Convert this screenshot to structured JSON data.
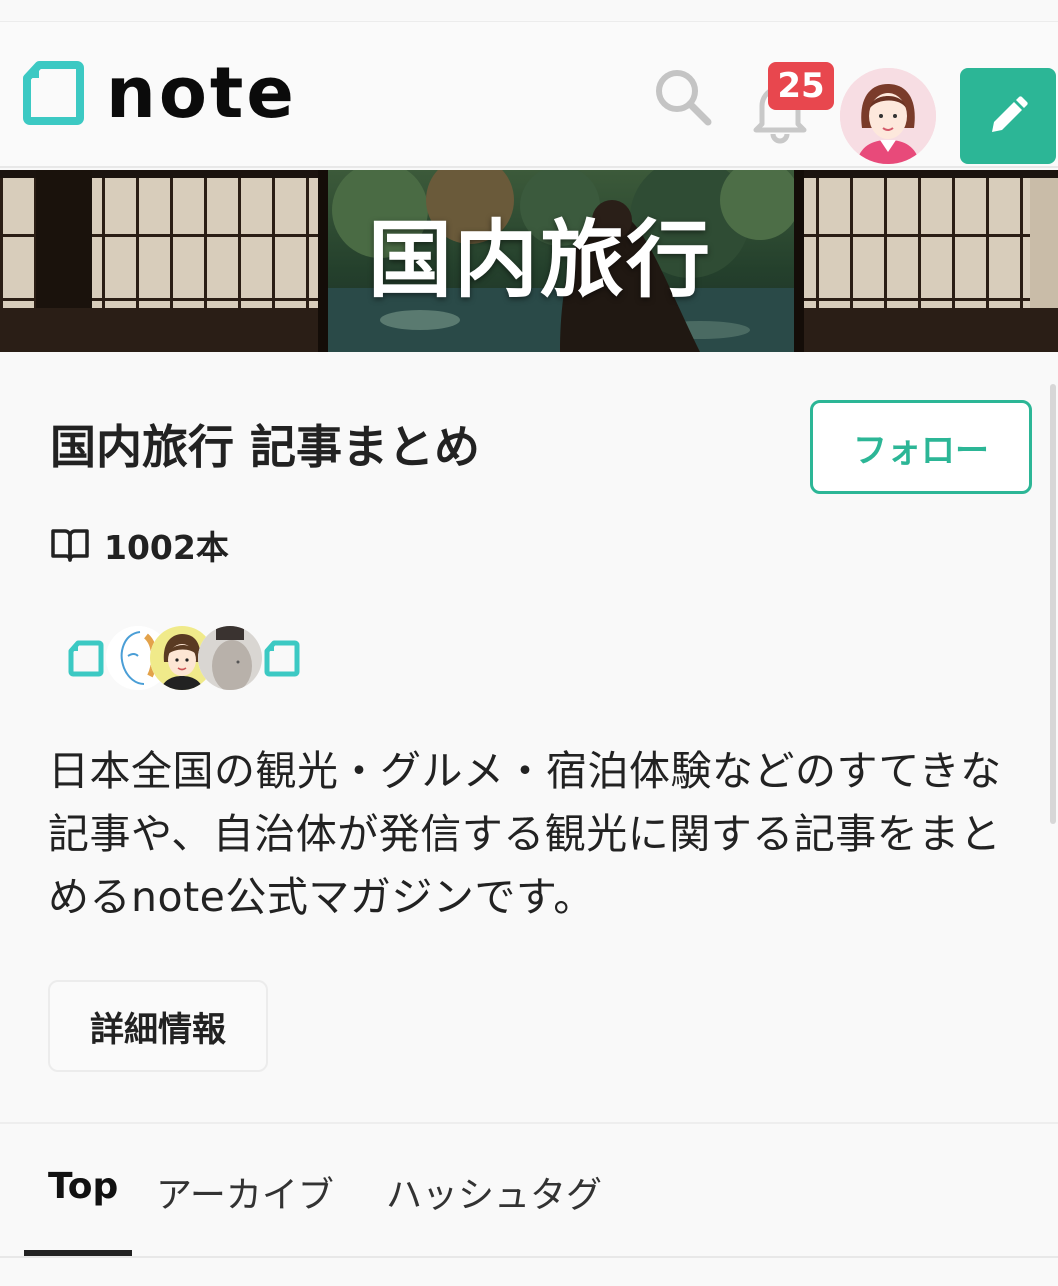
{
  "header": {
    "logo_text": "note",
    "notification_count": "25",
    "icons": {
      "logo": "note-logo-icon",
      "search": "search-icon",
      "notifications": "bell-icon",
      "avatar": "user-avatar",
      "post": "pencil-icon"
    },
    "accent_color": "#2cb696",
    "badge_color": "#e8474e"
  },
  "banner": {
    "title": "国内旅行"
  },
  "magazine": {
    "title": "国内旅行 記事まとめ",
    "follow_label": "フォロー",
    "article_count": "1002本",
    "count_icon": "book-icon",
    "description": "日本全国の観光・グルメ・宿泊体験などのすてきな記事や、自治体が発信する観光に関する記事をまとめるnote公式マガジンです。",
    "detail_label": "詳細情報"
  },
  "tabs": [
    {
      "label": "Top",
      "active": true
    },
    {
      "label": "アーカイブ",
      "active": false
    },
    {
      "label": "ハッシュタグ",
      "active": false
    }
  ]
}
